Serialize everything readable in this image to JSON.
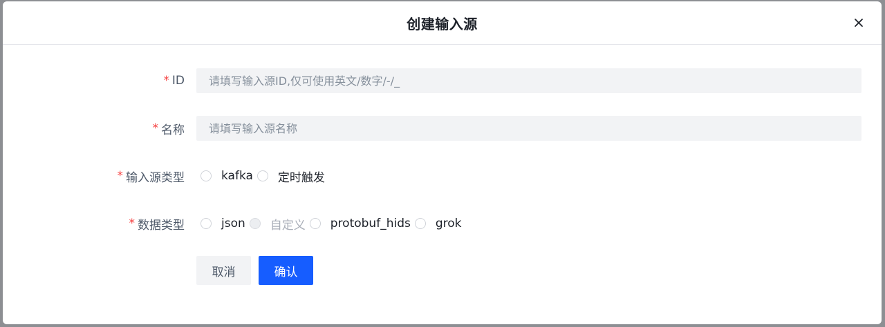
{
  "modal": {
    "title": "创建输入源"
  },
  "form": {
    "id": {
      "label": "ID",
      "placeholder": "请填写输入源ID,仅可使用英文/数字/-/_",
      "value": ""
    },
    "name": {
      "label": "名称",
      "placeholder": "请填写输入源名称",
      "value": ""
    },
    "source_type": {
      "label": "输入源类型",
      "options": [
        "kafka",
        "定时触发"
      ]
    },
    "data_type": {
      "label": "数据类型",
      "options": [
        "json",
        "自定义",
        "protobuf_hids",
        "grok"
      ],
      "disabled_option": "自定义"
    },
    "required_mark": "*"
  },
  "buttons": {
    "cancel": "取消",
    "confirm": "确认"
  },
  "colors": {
    "primary": "#165dff",
    "required": "#f53f3f",
    "input_bg": "#f2f3f5"
  }
}
